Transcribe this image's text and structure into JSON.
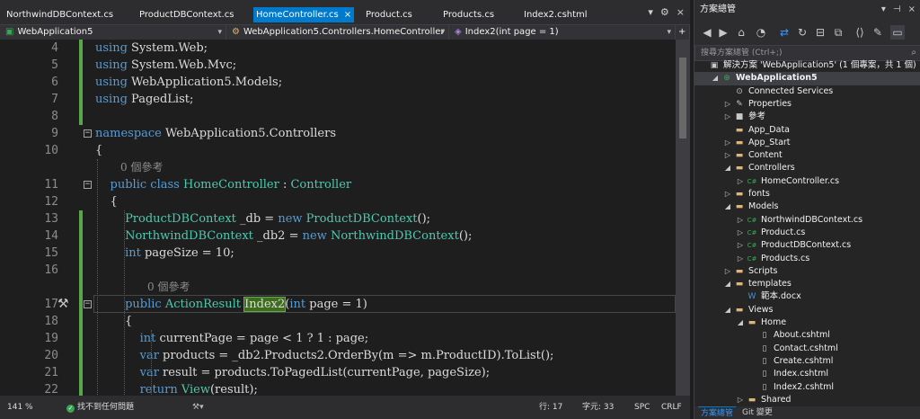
{
  "editor": {
    "tabs": [
      {
        "label": "NorthwindDBContext.cs",
        "active": false
      },
      {
        "label": "ProductDBContext.cs",
        "active": false
      },
      {
        "label": "HomeController.cs",
        "active": true
      },
      {
        "label": "Product.cs",
        "active": false
      },
      {
        "label": "Products.cs",
        "active": false
      },
      {
        "label": "Index2.cshtml",
        "active": false
      }
    ],
    "tab_close_glyph": "×",
    "tab_controls": {
      "dropdown": "▾",
      "settings": "⚙",
      "close": "×"
    },
    "nav": {
      "project": "WebApplication5",
      "class": "WebApplication5.Controllers.HomeController",
      "member": "Index2(int page = 1)",
      "split": "+"
    },
    "code_lines": [
      {
        "num": "4",
        "text": "using System.Web;"
      },
      {
        "num": "5",
        "text": "using System.Web.Mvc;"
      },
      {
        "num": "6",
        "text": "using WebApplication5.Models;"
      },
      {
        "num": "7",
        "text": "using PagedList;"
      },
      {
        "num": "8",
        "text": ""
      },
      {
        "num": "9",
        "text": "namespace WebApplication5.Controllers"
      },
      {
        "num": "10",
        "text": "{"
      },
      {
        "num": "11",
        "text": "    public class HomeController : Controller"
      },
      {
        "num": "12",
        "text": "    {"
      },
      {
        "num": "13",
        "text": "        ProductDBContext _db = new ProductDBContext();"
      },
      {
        "num": "14",
        "text": "        NorthwindDBContext _db2 = new NorthwindDBContext();"
      },
      {
        "num": "15",
        "text": "        int pageSize = 10;"
      },
      {
        "num": "16",
        "text": ""
      },
      {
        "num": "17",
        "text": "        public ActionResult Index2(int page = 1)"
      },
      {
        "num": "18",
        "text": "        {"
      },
      {
        "num": "19",
        "text": "            int currentPage = page < 1 ? 1 : page;"
      },
      {
        "num": "20",
        "text": "            var products = _db2.Products2.OrderBy(m => m.ProductID).ToList();"
      },
      {
        "num": "21",
        "text": "            var result = products.ToPagedList(currentPage, pageSize);"
      },
      {
        "num": "22",
        "text": "            return View(result);"
      }
    ],
    "references": [
      {
        "after": "10",
        "text": "0 個參考"
      },
      {
        "after": "16",
        "text": "0 個參考"
      }
    ],
    "status": {
      "zoom": "141 %",
      "issues": "找不到任何問題",
      "line": "行: 17",
      "col": "字元: 33",
      "spc": "SPC",
      "crlf": "CRLF"
    }
  },
  "explorer": {
    "title": "方案總管",
    "title_controls": {
      "dropdown": "▾",
      "pin": "⊣",
      "close": "×"
    },
    "search_placeholder": "搜尋方案總管 (Ctrl+;)",
    "tree": [
      {
        "label": "解決方案 'WebApplication5' (1 個專案，共 1 個)",
        "level": 0,
        "chev": "",
        "icon": "▣",
        "icon_color": "#c8c8c8",
        "selected": false
      },
      {
        "label": "WebApplication5",
        "level": 1,
        "chev": "◢",
        "icon": "⊕",
        "icon_color": "#3aa655",
        "selected": true,
        "bold": true
      },
      {
        "label": "Connected Services",
        "level": 2,
        "chev": "",
        "icon": "⊙",
        "icon_color": "#c8c8c8",
        "selected": false
      },
      {
        "label": "Properties",
        "level": 2,
        "chev": "▷",
        "icon": "✎",
        "icon_color": "#c8c8c8",
        "selected": false
      },
      {
        "label": "參考",
        "level": 2,
        "chev": "▷",
        "icon": "■",
        "icon_color": "#c8c8c8",
        "selected": false
      },
      {
        "label": "App_Data",
        "level": 2,
        "chev": "",
        "icon": "▬",
        "icon_color": "#dcb67a",
        "selected": false
      },
      {
        "label": "App_Start",
        "level": 2,
        "chev": "▷",
        "icon": "▬",
        "icon_color": "#dcb67a",
        "selected": false
      },
      {
        "label": "Content",
        "level": 2,
        "chev": "▷",
        "icon": "▬",
        "icon_color": "#dcb67a",
        "selected": false
      },
      {
        "label": "Controllers",
        "level": 2,
        "chev": "◢",
        "icon": "▬",
        "icon_color": "#dcb67a",
        "selected": false
      },
      {
        "label": "HomeController.cs",
        "level": 3,
        "chev": "▷",
        "icon": "C#",
        "icon_color": "#3aa655",
        "selected": false
      },
      {
        "label": "fonts",
        "level": 2,
        "chev": "▷",
        "icon": "▬",
        "icon_color": "#dcb67a",
        "selected": false
      },
      {
        "label": "Models",
        "level": 2,
        "chev": "◢",
        "icon": "▬",
        "icon_color": "#dcb67a",
        "selected": false
      },
      {
        "label": "NorthwindDBContext.cs",
        "level": 3,
        "chev": "▷",
        "icon": "C#",
        "icon_color": "#3aa655",
        "selected": false
      },
      {
        "label": "Product.cs",
        "level": 3,
        "chev": "▷",
        "icon": "C#",
        "icon_color": "#3aa655",
        "selected": false
      },
      {
        "label": "ProductDBContext.cs",
        "level": 3,
        "chev": "▷",
        "icon": "C#",
        "icon_color": "#3aa655",
        "selected": false
      },
      {
        "label": "Products.cs",
        "level": 3,
        "chev": "▷",
        "icon": "C#",
        "icon_color": "#3aa655",
        "selected": false
      },
      {
        "label": "Scripts",
        "level": 2,
        "chev": "▷",
        "icon": "▬",
        "icon_color": "#dcb67a",
        "selected": false
      },
      {
        "label": "templates",
        "level": 2,
        "chev": "◢",
        "icon": "▬",
        "icon_color": "#dcb67a",
        "selected": false
      },
      {
        "label": "範本.docx",
        "level": 3,
        "chev": "",
        "icon": "W",
        "icon_color": "#4a90d9",
        "selected": false
      },
      {
        "label": "Views",
        "level": 2,
        "chev": "◢",
        "icon": "▬",
        "icon_color": "#dcb67a",
        "selected": false
      },
      {
        "label": "Home",
        "level": 3,
        "chev": "◢",
        "icon": "▬",
        "icon_color": "#dcb67a",
        "selected": false
      },
      {
        "label": "About.cshtml",
        "level": 4,
        "chev": "",
        "icon": "▯",
        "icon_color": "#c8c8c8",
        "selected": false
      },
      {
        "label": "Contact.cshtml",
        "level": 4,
        "chev": "",
        "icon": "▯",
        "icon_color": "#c8c8c8",
        "selected": false
      },
      {
        "label": "Create.cshtml",
        "level": 4,
        "chev": "",
        "icon": "▯",
        "icon_color": "#c8c8c8",
        "selected": false
      },
      {
        "label": "Index.cshtml",
        "level": 4,
        "chev": "",
        "icon": "▯",
        "icon_color": "#c8c8c8",
        "selected": false
      },
      {
        "label": "Index2.cshtml",
        "level": 4,
        "chev": "",
        "icon": "▯",
        "icon_color": "#c8c8c8",
        "selected": false
      },
      {
        "label": "Shared",
        "level": 3,
        "chev": "▷",
        "icon": "▬",
        "icon_color": "#dcb67a",
        "selected": false
      }
    ],
    "bottom_tabs": [
      {
        "label": "方案總管",
        "active": true
      },
      {
        "label": "Git 變更",
        "active": false
      }
    ]
  },
  "colors": {
    "accent": "#007acc",
    "keyword": "#569cd6",
    "type": "#4ec9b0",
    "change_bar": "#57a64a"
  }
}
